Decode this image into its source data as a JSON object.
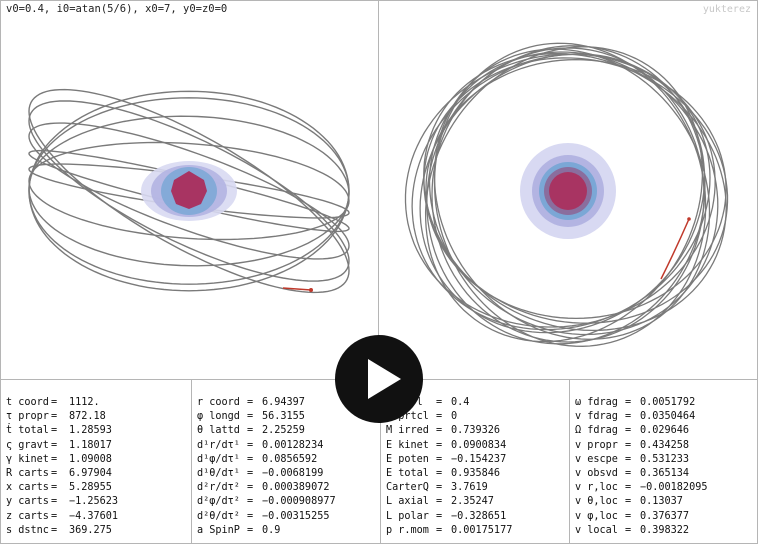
{
  "header": {
    "params": "v0=0.4, i0=atan(5/6), x0=7, y0=z0=0",
    "watermark": "yukterez"
  },
  "colors": {
    "orbit": "#7a7a7a",
    "trail": "#c0392b",
    "horizon_outer": "#d8d9f2",
    "horizon_mid": "#b3b4e2",
    "ergosphere": "#7ba7d6",
    "core": "#a83462",
    "divider": "#b5b5b5"
  },
  "play_icon": "play-icon",
  "readouts": [
    {
      "rows": [
        {
          "label": "t coord",
          "value": "1112."
        },
        {
          "label": "τ propr",
          "value": "872.18"
        },
        {
          "label": "ṫ total",
          "value": "1.28593"
        },
        {
          "label": "ς gravt",
          "value": "1.18017"
        },
        {
          "label": "γ kinet",
          "value": "1.09008"
        },
        {
          "label": "R carts",
          "value": "6.97904"
        },
        {
          "label": "x carts",
          "value": "5.28955"
        },
        {
          "label": "y carts",
          "value": "−1.25623"
        },
        {
          "label": "z carts",
          "value": "−4.37601"
        },
        {
          "label": "s dstnc",
          "value": "369.275"
        }
      ]
    },
    {
      "rows": [
        {
          "label": "r coord",
          "value": "6.94397"
        },
        {
          "label": "φ longd",
          "value": "56.3155"
        },
        {
          "label": "θ lattd",
          "value": "2.25259"
        },
        {
          "label": "d¹r/dτ¹",
          "value": "0.00128234"
        },
        {
          "label": "d¹φ/dτ¹",
          "value": "0.0856592"
        },
        {
          "label": "d¹θ/dτ¹",
          "value": "−0.0068199"
        },
        {
          "label": "d²r/dτ²",
          "value": "0.000389072"
        },
        {
          "label": "d²φ/dτ²",
          "value": "−0.000908977"
        },
        {
          "label": "d²θ/dτ²",
          "value": "−0.00315255"
        },
        {
          "label": "a SpinP",
          "value": "0.9"
        }
      ]
    },
    {
      "rows": [
        {
          "label": "v ctrl",
          "value": "0.4"
        },
        {
          "label": "q prtcl",
          "value": "0"
        },
        {
          "label": "M irred",
          "value": "0.739326"
        },
        {
          "label": "E kinet",
          "value": "0.0900834"
        },
        {
          "label": "E poten",
          "value": "−0.154237"
        },
        {
          "label": "E total",
          "value": "0.935846"
        },
        {
          "label": "CarterQ",
          "value": "3.7619"
        },
        {
          "label": "L axial",
          "value": "2.35247"
        },
        {
          "label": "L polar",
          "value": "−0.328651"
        },
        {
          "label": "p r.mom",
          "value": "0.00175177"
        }
      ]
    },
    {
      "rows": [
        {
          "label": "ω fdrag",
          "value": "0.0051792"
        },
        {
          "label": "v fdrag",
          "value": "0.0350464"
        },
        {
          "label": "Ω fdrag",
          "value": "0.029646"
        },
        {
          "label": "v propr",
          "value": "0.434258"
        },
        {
          "label": "v escpe",
          "value": "0.531233"
        },
        {
          "label": "v obsvd",
          "value": "0.365134"
        },
        {
          "label": "v r,loc",
          "value": "−0.00182095"
        },
        {
          "label": "v θ,loc",
          "value": "0.13037"
        },
        {
          "label": "v φ,loc",
          "value": "0.376377"
        },
        {
          "label": "v local",
          "value": "0.398322"
        }
      ]
    }
  ]
}
